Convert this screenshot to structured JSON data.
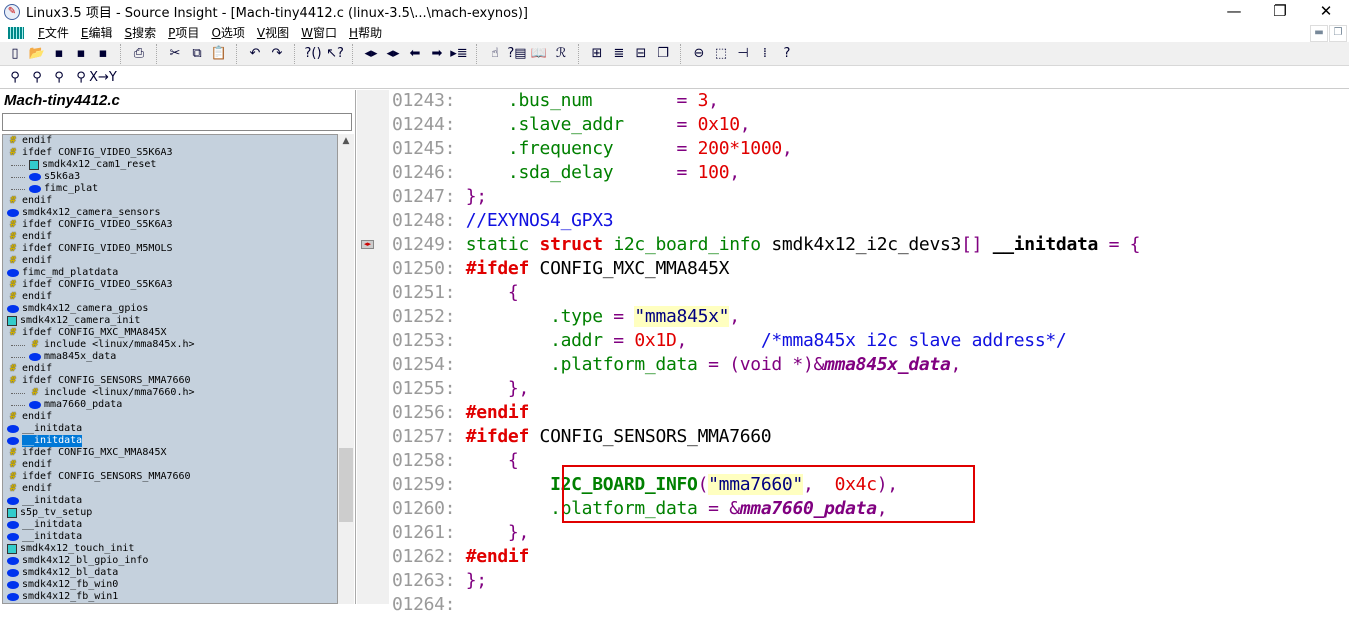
{
  "window": {
    "title": "Linux3.5 项目 - Source Insight - [Mach-tiny4412.c (linux-3.5\\...\\mach-exynos)]"
  },
  "menu": [
    {
      "key": "F",
      "label": "文件"
    },
    {
      "key": "E",
      "label": "编辑"
    },
    {
      "key": "S",
      "label": "搜索"
    },
    {
      "key": "P",
      "label": "项目"
    },
    {
      "key": "O",
      "label": "选项"
    },
    {
      "key": "V",
      "label": "视图"
    },
    {
      "key": "W",
      "label": "窗口"
    },
    {
      "key": "H",
      "label": "帮助"
    }
  ],
  "toolbar1": [
    [
      "new-file",
      "▯"
    ],
    [
      "open-file",
      "📂"
    ],
    [
      "save",
      "▪"
    ],
    [
      "save-as",
      "▪"
    ],
    [
      "save-all",
      "▪"
    ],
    "|",
    [
      "print",
      "⎙"
    ],
    "|",
    [
      "cut",
      "✂"
    ],
    [
      "copy",
      "⧉"
    ],
    [
      "paste",
      "📋"
    ],
    "|",
    [
      "undo",
      "↶"
    ],
    [
      "redo",
      "↷"
    ],
    "|",
    [
      "parenthesis",
      "?()"
    ],
    [
      "context-help",
      "↖?"
    ],
    "|",
    [
      "jump-back",
      "◂▸"
    ],
    [
      "jump-forward",
      "◂▸"
    ],
    [
      "back",
      "⬅"
    ],
    [
      "forward",
      "➡"
    ],
    [
      "outline",
      "▸≣"
    ],
    "|",
    [
      "lookup-references",
      "☝"
    ],
    [
      "symbol-info",
      "?▤"
    ],
    [
      "browse",
      "📖"
    ],
    [
      "relation",
      "ℛ"
    ],
    "|",
    [
      "tile-windows",
      "⊞"
    ],
    [
      "page-view",
      "≣"
    ],
    [
      "split-view",
      "⊟"
    ],
    [
      "cascade",
      "❐"
    ],
    "|",
    [
      "activate",
      "⊖"
    ],
    [
      "resize",
      "⬚"
    ],
    [
      "tree",
      "⊣"
    ],
    [
      "layout",
      "⁞"
    ],
    [
      "help",
      "?"
    ]
  ],
  "toolbar2": [
    [
      "find",
      "⚲"
    ],
    [
      "find-prev",
      "⚲"
    ],
    [
      "find-next",
      "⚲"
    ],
    [
      "find-files",
      "⚲"
    ],
    [
      "replace",
      "X→Y"
    ]
  ],
  "panel": {
    "title": "Mach-tiny4412.c",
    "search_value": ""
  },
  "tree": [
    {
      "t": "endif",
      "i": "hash",
      "l": 0
    },
    {
      "t": "ifdef CONFIG_VIDEO_S5K6A3",
      "i": "hash",
      "l": 0
    },
    {
      "t": "smdk4x12_cam1_reset",
      "i": "func",
      "l": 1
    },
    {
      "t": "s5k6a3",
      "i": "var",
      "l": 1
    },
    {
      "t": "fimc_plat",
      "i": "var",
      "l": 1
    },
    {
      "t": "endif",
      "i": "hash",
      "l": 0
    },
    {
      "t": "smdk4x12_camera_sensors",
      "i": "var",
      "l": 0
    },
    {
      "t": "ifdef CONFIG_VIDEO_S5K6A3",
      "i": "hash",
      "l": 0
    },
    {
      "t": "endif",
      "i": "hash",
      "l": 0
    },
    {
      "t": "ifdef CONFIG_VIDEO_M5MOLS",
      "i": "hash",
      "l": 0
    },
    {
      "t": "endif",
      "i": "hash",
      "l": 0
    },
    {
      "t": "fimc_md_platdata",
      "i": "var",
      "l": 0
    },
    {
      "t": "ifdef CONFIG_VIDEO_S5K6A3",
      "i": "hash",
      "l": 0
    },
    {
      "t": "endif",
      "i": "hash",
      "l": 0
    },
    {
      "t": "smdk4x12_camera_gpios",
      "i": "var",
      "l": 0
    },
    {
      "t": "smdk4x12_camera_init",
      "i": "func",
      "l": 0
    },
    {
      "t": "ifdef CONFIG_MXC_MMA845X",
      "i": "hash",
      "l": 0
    },
    {
      "t": "include <linux/mma845x.h>",
      "i": "hash",
      "l": 1
    },
    {
      "t": "mma845x_data",
      "i": "var",
      "l": 1
    },
    {
      "t": "endif",
      "i": "hash",
      "l": 0
    },
    {
      "t": "ifdef CONFIG_SENSORS_MMA7660",
      "i": "hash",
      "l": 0
    },
    {
      "t": "include <linux/mma7660.h>",
      "i": "hash",
      "l": 1
    },
    {
      "t": "mma7660_pdata",
      "i": "var",
      "l": 1
    },
    {
      "t": "endif",
      "i": "hash",
      "l": 0
    },
    {
      "t": "__initdata",
      "i": "var",
      "l": 0
    },
    {
      "t": "__initdata",
      "i": "var",
      "l": 0,
      "sel": true
    },
    {
      "t": "ifdef CONFIG_MXC_MMA845X",
      "i": "hash",
      "l": 0
    },
    {
      "t": "endif",
      "i": "hash",
      "l": 0
    },
    {
      "t": "ifdef CONFIG_SENSORS_MMA7660",
      "i": "hash",
      "l": 0
    },
    {
      "t": "endif",
      "i": "hash",
      "l": 0
    },
    {
      "t": "__initdata",
      "i": "var",
      "l": 0
    },
    {
      "t": "s5p_tv_setup",
      "i": "func",
      "l": 0
    },
    {
      "t": "__initdata",
      "i": "var",
      "l": 0
    },
    {
      "t": "__initdata",
      "i": "var",
      "l": 0
    },
    {
      "t": "smdk4x12_touch_init",
      "i": "func",
      "l": 0
    },
    {
      "t": "smdk4x12_bl_gpio_info",
      "i": "var",
      "l": 0
    },
    {
      "t": "smdk4x12_bl_data",
      "i": "var",
      "l": 0
    },
    {
      "t": "smdk4x12_fb_win0",
      "i": "var",
      "l": 0
    },
    {
      "t": "smdk4x12_fb_win1",
      "i": "var",
      "l": 0
    }
  ],
  "code": [
    {
      "n": "01243:",
      "tk": [
        [
          "k",
          "    "
        ],
        [
          "g",
          ".bus_num"
        ],
        [
          "k",
          "        "
        ],
        [
          "p",
          "="
        ],
        [
          "k",
          " "
        ],
        [
          "r",
          "3"
        ],
        [
          "p",
          ","
        ]
      ]
    },
    {
      "n": "01244:",
      "tk": [
        [
          "k",
          "    "
        ],
        [
          "g",
          ".slave_addr"
        ],
        [
          "k",
          "     "
        ],
        [
          "p",
          "="
        ],
        [
          "k",
          " "
        ],
        [
          "r",
          "0x10"
        ],
        [
          "p",
          ","
        ]
      ]
    },
    {
      "n": "01245:",
      "tk": [
        [
          "k",
          "    "
        ],
        [
          "g",
          ".frequency"
        ],
        [
          "k",
          "      "
        ],
        [
          "p",
          "="
        ],
        [
          "k",
          " "
        ],
        [
          "r",
          "200*1000"
        ],
        [
          "p",
          ","
        ]
      ]
    },
    {
      "n": "01246:",
      "tk": [
        [
          "k",
          "    "
        ],
        [
          "g",
          ".sda_delay"
        ],
        [
          "k",
          "      "
        ],
        [
          "p",
          "="
        ],
        [
          "k",
          " "
        ],
        [
          "r",
          "100"
        ],
        [
          "p",
          ","
        ]
      ]
    },
    {
      "n": "01247:",
      "tk": [
        [
          "p",
          "};"
        ]
      ]
    },
    {
      "n": "01248:",
      "tk": [
        [
          "c",
          "//EXYNOS4_GPX3"
        ]
      ]
    },
    {
      "n": "01249:",
      "tk": [
        [
          "g",
          "static"
        ],
        [
          "k",
          " "
        ],
        [
          "kw",
          "struct"
        ],
        [
          "k",
          " "
        ],
        [
          "g",
          "i2c_board_info"
        ],
        [
          "k",
          " smdk4x12_i2c_devs3"
        ],
        [
          "p",
          "[]"
        ],
        [
          "k",
          " "
        ],
        [
          "b",
          "__initdata"
        ],
        [
          "k",
          " "
        ],
        [
          "p",
          "= {"
        ]
      ]
    },
    {
      "n": "01250:",
      "tk": [
        [
          "kw",
          "#ifdef"
        ],
        [
          "k",
          " CONFIG_MXC_MMA845X"
        ]
      ]
    },
    {
      "n": "01251:",
      "tk": [
        [
          "k",
          "    "
        ],
        [
          "p",
          "{"
        ]
      ]
    },
    {
      "n": "01252:",
      "tk": [
        [
          "k",
          "        "
        ],
        [
          "g",
          ".type"
        ],
        [
          "k",
          " "
        ],
        [
          "p",
          "="
        ],
        [
          "k",
          " "
        ],
        [
          "s",
          "\"mma845x\""
        ],
        [
          "p",
          ","
        ]
      ]
    },
    {
      "n": "01253:",
      "tk": [
        [
          "k",
          "        "
        ],
        [
          "g",
          ".addr"
        ],
        [
          "k",
          " "
        ],
        [
          "p",
          "="
        ],
        [
          "k",
          " "
        ],
        [
          "r",
          "0x1D"
        ],
        [
          "p",
          ","
        ],
        [
          "k",
          "       "
        ],
        [
          "c",
          "/*mma845x i2c slave address*/"
        ]
      ]
    },
    {
      "n": "01254:",
      "tk": [
        [
          "k",
          "        "
        ],
        [
          "g",
          ".platform_data"
        ],
        [
          "k",
          " "
        ],
        [
          "p",
          "= (void *)&"
        ],
        [
          "m",
          "mma845x_data"
        ],
        [
          "p",
          ","
        ]
      ]
    },
    {
      "n": "01255:",
      "tk": [
        [
          "k",
          "    "
        ],
        [
          "p",
          "},"
        ]
      ]
    },
    {
      "n": "01256:",
      "tk": [
        [
          "kw",
          "#endif"
        ]
      ]
    },
    {
      "n": "01257:",
      "tk": [
        [
          "kw",
          "#ifdef"
        ],
        [
          "k",
          " CONFIG_SENSORS_MMA7660"
        ]
      ]
    },
    {
      "n": "01258:",
      "tk": [
        [
          "k",
          "    "
        ],
        [
          "p",
          "{"
        ]
      ]
    },
    {
      "n": "01259:",
      "tk": [
        [
          "k",
          "        "
        ],
        [
          "mac",
          "I2C_BOARD_INFO"
        ],
        [
          "p",
          "("
        ],
        [
          "s",
          "\"mma7660\""
        ],
        [
          "p",
          ", "
        ],
        [
          "r",
          " 0x4c"
        ],
        [
          "p",
          "),"
        ]
      ]
    },
    {
      "n": "01260:",
      "tk": [
        [
          "k",
          "        "
        ],
        [
          "g",
          ".platform_data"
        ],
        [
          "k",
          " "
        ],
        [
          "p",
          "= &"
        ],
        [
          "m",
          "mma7660_pdata"
        ],
        [
          "p",
          ","
        ]
      ]
    },
    {
      "n": "01261:",
      "tk": [
        [
          "k",
          "    "
        ],
        [
          "p",
          "},"
        ]
      ]
    },
    {
      "n": "01262:",
      "tk": [
        [
          "kw",
          "#endif"
        ]
      ]
    },
    {
      "n": "01263:",
      "tk": [
        [
          "p",
          "};"
        ]
      ]
    },
    {
      "n": "01264:",
      "tk": []
    }
  ]
}
